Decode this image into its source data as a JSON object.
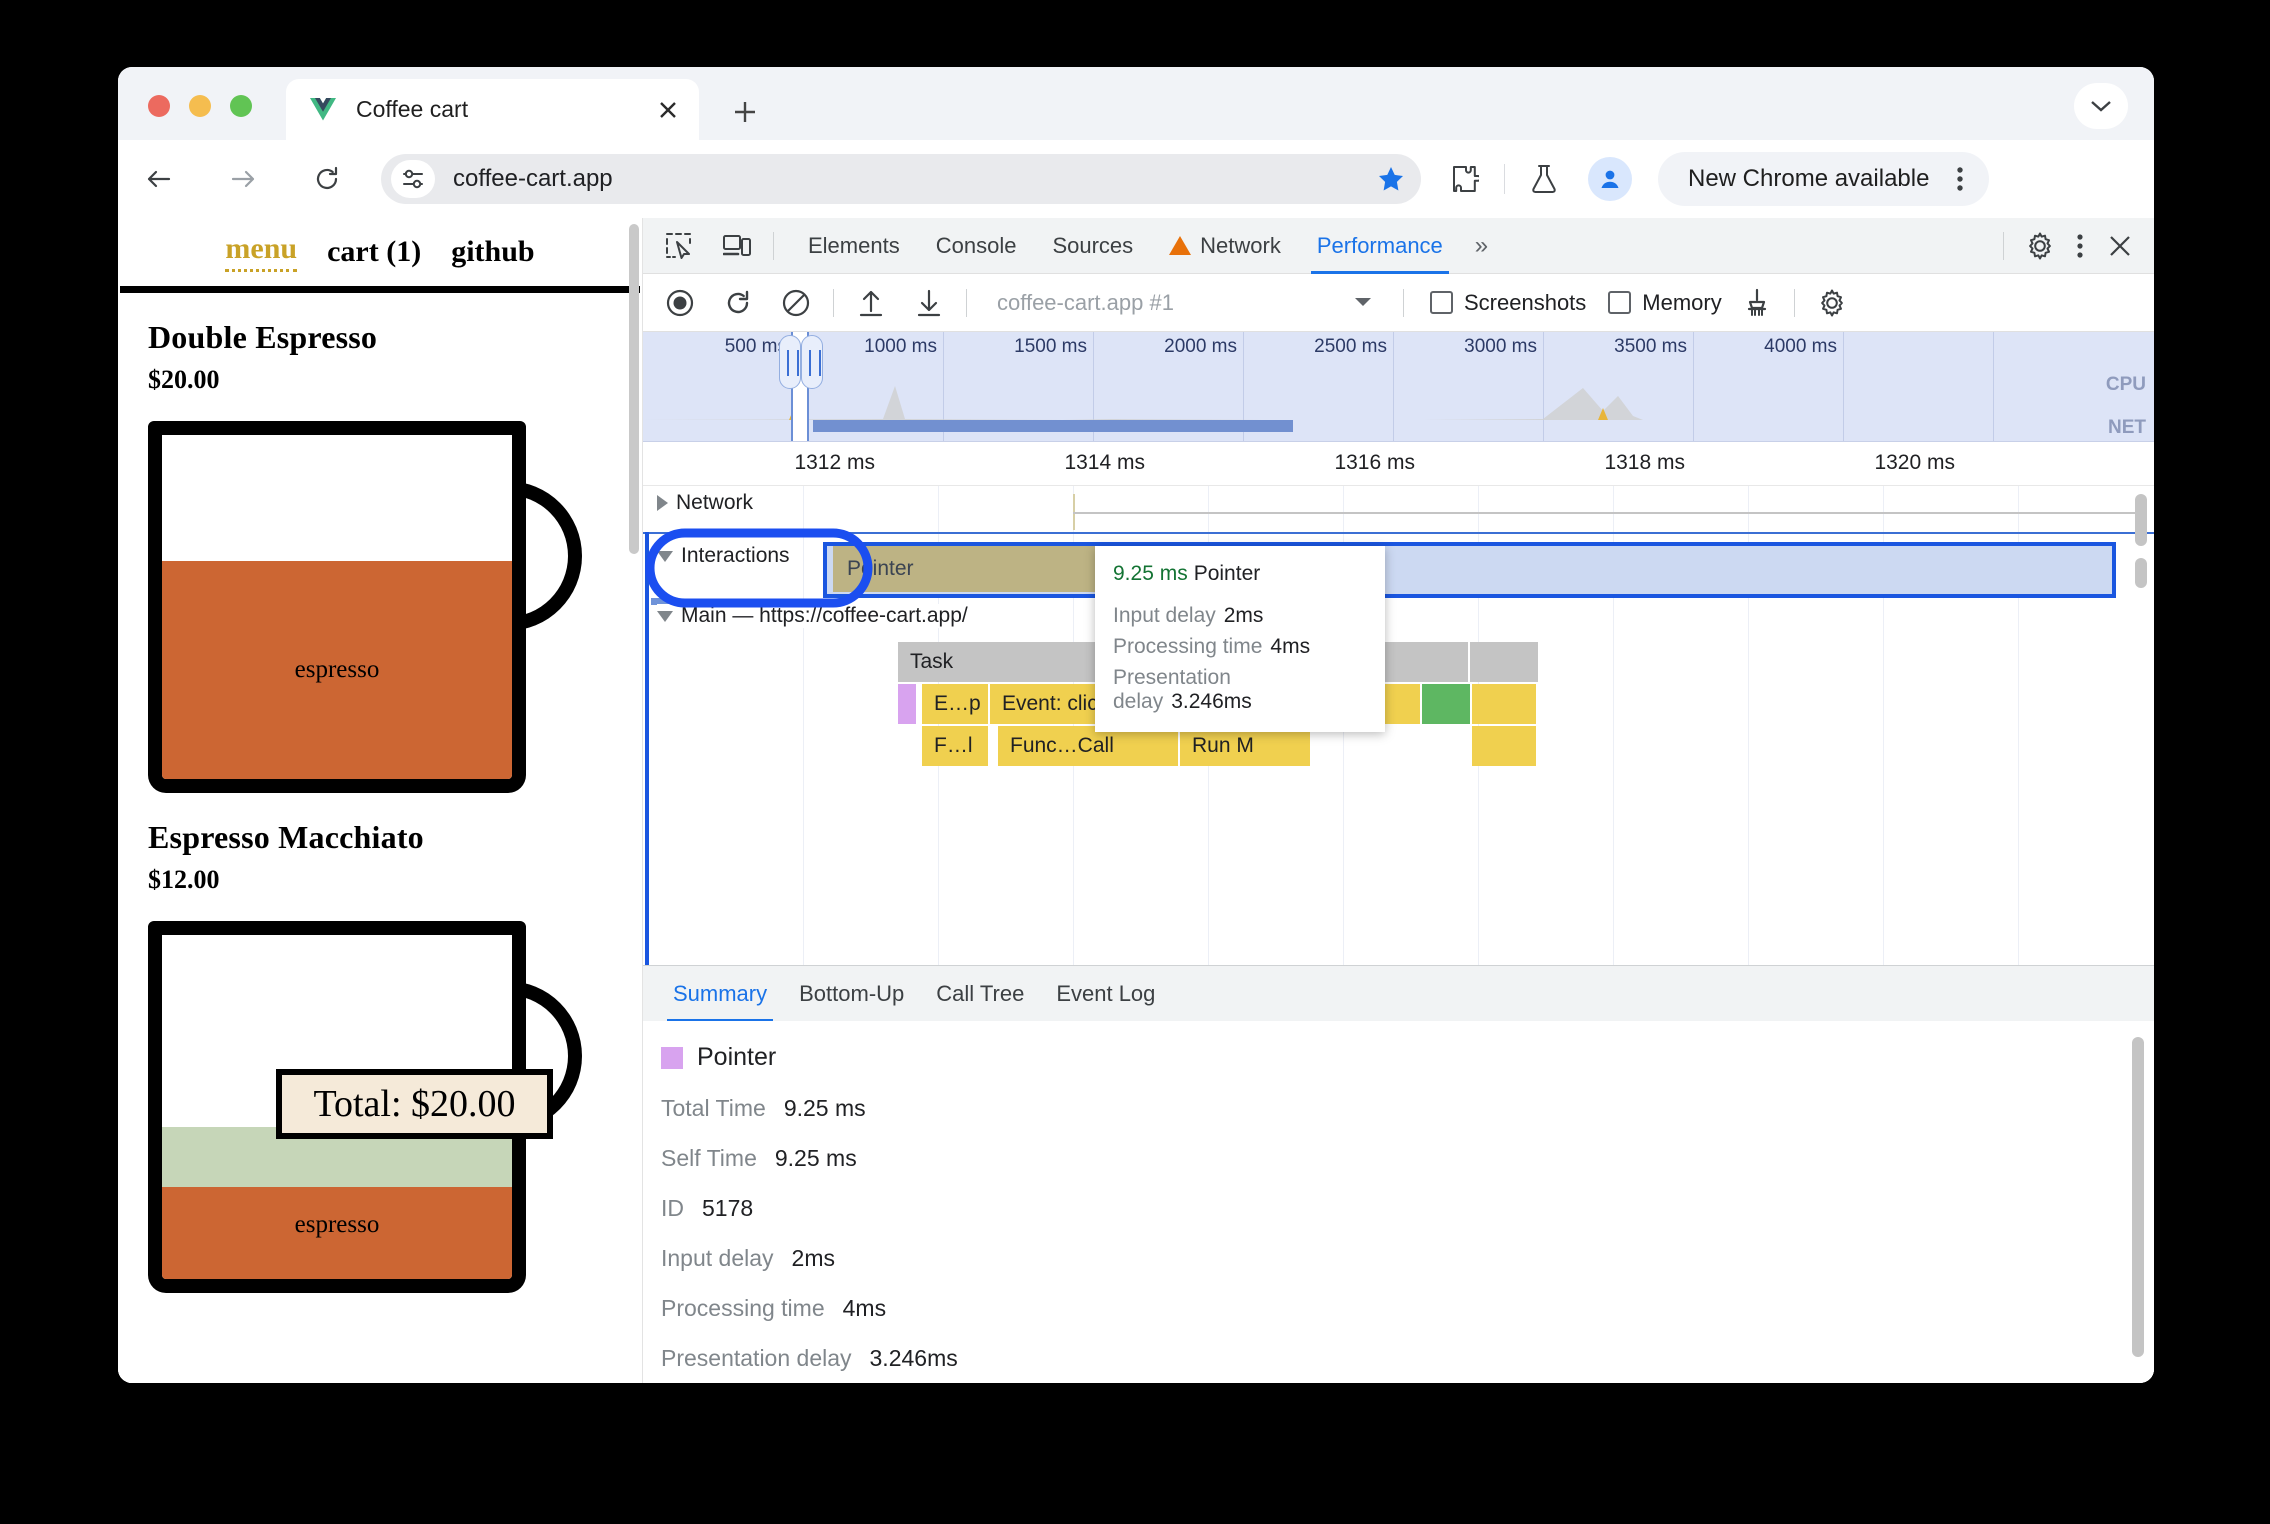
{
  "browser": {
    "tab": {
      "title": "Coffee cart",
      "favicon_icon": "vue-logo-icon",
      "close_icon": "close-icon"
    },
    "new_tab_label": "+",
    "tabstrip_expand_icon": "chevron-down-icon",
    "toolbar": {
      "back_icon": "arrow-left-icon",
      "forward_icon": "arrow-right-icon",
      "reload_icon": "reload-icon",
      "site_settings_icon": "tune-icon",
      "url": "coffee-cart.app",
      "bookmark_icon": "star-filled-icon",
      "extensions_icon": "puzzle-piece-icon",
      "labs_icon": "flask-icon",
      "profile_icon": "person-icon",
      "update_label": "New Chrome available",
      "menu_icon": "kebab-menu-icon"
    }
  },
  "page": {
    "nav": [
      {
        "label": "menu",
        "active": true
      },
      {
        "label": "cart (1)",
        "active": false
      },
      {
        "label": "github",
        "active": false
      }
    ],
    "products": [
      {
        "name": "Double Espresso",
        "price": "$20.00",
        "cup_label": "espresso"
      },
      {
        "name": "Espresso Macchiato",
        "price": "$12.00",
        "cup_label": "espresso"
      }
    ],
    "total_tooltip": "Total: $20.00"
  },
  "devtools": {
    "inspect_icon": "inspect-element-icon",
    "device_toolbar_icon": "device-toolbar-icon",
    "tabs": [
      {
        "label": "Elements",
        "selected": false,
        "warning": false
      },
      {
        "label": "Console",
        "selected": false,
        "warning": false
      },
      {
        "label": "Sources",
        "selected": false,
        "warning": false
      },
      {
        "label": "Network",
        "selected": false,
        "warning": true
      },
      {
        "label": "Performance",
        "selected": true,
        "warning": false
      }
    ],
    "more_tabs_label": "»",
    "settings_icon": "gear-icon",
    "menu_icon": "kebab-menu-icon",
    "close_icon": "close-icon",
    "controls": {
      "record_icon": "record-circle-icon",
      "reload_record_icon": "reload-record-icon",
      "clear_icon": "clear-prohibited-icon",
      "load_icon": "upload-arrow-icon",
      "save_icon": "download-arrow-icon",
      "session_name": "coffee-cart.app #1",
      "session_caret_icon": "caret-down-icon",
      "screenshots_label": "Screenshots",
      "screenshots_checked": false,
      "memory_label": "Memory",
      "memory_checked": false,
      "gc_icon": "broom-icon",
      "capture_settings_icon": "gear-icon"
    },
    "overview": {
      "ticks": [
        "500 ms",
        "1000 ms",
        "1500 ms",
        "2000 ms",
        "2500 ms",
        "3000 ms",
        "3500 ms",
        "4000 ms"
      ],
      "cpu_label": "CPU",
      "net_label": "NET"
    },
    "timeline": {
      "ticks": [
        "1312 ms",
        "1314 ms",
        "1316 ms",
        "1318 ms",
        "1320 ms"
      ],
      "tracks": [
        {
          "name": "Network",
          "expanded": false
        },
        {
          "name": "Interactions",
          "expanded": true
        },
        {
          "name": "Main — https://coffee-cart.app/",
          "expanded": true
        }
      ],
      "interaction_bar": "Pointer",
      "flame_bars": [
        {
          "label": "Task",
          "color": "gray"
        },
        {
          "label": "E…p",
          "color": "yellow"
        },
        {
          "label": "Event: click",
          "color": "yellow"
        },
        {
          "label": "F…l",
          "color": "yellow"
        },
        {
          "label": "Func…Call",
          "color": "yellow"
        },
        {
          "label": "Run M",
          "color": "yellow"
        }
      ]
    },
    "tooltip": {
      "duration": "9.25 ms",
      "name": "Pointer",
      "rows": [
        {
          "key": "Input delay",
          "value": "2ms"
        },
        {
          "key": "Processing time",
          "value": "4ms"
        },
        {
          "key": "Presentation delay",
          "value": "3.246ms"
        }
      ]
    },
    "bottom_tabs": [
      {
        "label": "Summary",
        "selected": true
      },
      {
        "label": "Bottom-Up",
        "selected": false
      },
      {
        "label": "Call Tree",
        "selected": false
      },
      {
        "label": "Event Log",
        "selected": false
      }
    ],
    "summary": {
      "title": "Pointer",
      "swatch_color": "#d8a3ef",
      "rows": [
        {
          "key": "Total Time",
          "value": "9.25 ms"
        },
        {
          "key": "Self Time",
          "value": "9.25 ms"
        },
        {
          "key": "ID",
          "value": "5178"
        },
        {
          "key": "Input delay",
          "value": "2ms"
        },
        {
          "key": "Processing time",
          "value": "4ms"
        },
        {
          "key": "Presentation delay",
          "value": "3.246ms"
        }
      ]
    }
  },
  "colors": {
    "accent_blue": "#1a73e8",
    "selection_blue": "#1a56e0",
    "pointer_bar": "#bdb384",
    "flame_yellow": "#f0d04f",
    "flame_green": "#5eb762",
    "flame_gray": "#c4c4c4",
    "flame_purple": "#d8a3ef",
    "espresso_orange": "#cc6633",
    "milk_green": "#c6d6b8",
    "tooltip_cream": "#f5ead9",
    "vue_green": "#42b883"
  }
}
